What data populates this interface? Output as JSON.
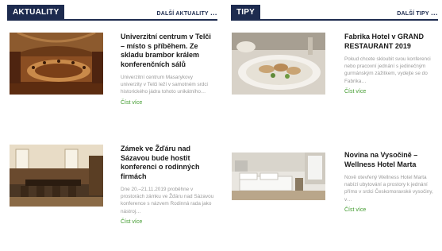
{
  "news": {
    "heading": "AKTUALITY",
    "more_label": "DALŠÍ AKTUALITY",
    "articles": [
      {
        "title": "Univerzitní centrum v Telči – místo s příběhem. Ze skladu brambor králem konferenčních sálů",
        "excerpt": "Univerzitní centrum Masarykovy univerzity v Telči leží v samotném srdci historického jádra tohoto unikátního…",
        "more": "Číst více"
      },
      {
        "title": "Zámek ve Žďáru nad Sázavou bude hostit konferenci o rodinných firmách",
        "excerpt": "Dne 20.–21.11.2019 proběhne v prostorách zámku ve Žďáru nad Sázavou konference s názvem Rodinná rada jako nástroj…",
        "more": "Číst více"
      }
    ]
  },
  "tips": {
    "heading": "TIPY",
    "more_label": "DALŠÍ TIPY",
    "articles": [
      {
        "title": "Fabrika Hotel v GRAND RESTAURANT 2019",
        "excerpt": "Pokud chcete skloubit svou konferenci nebo pracovní jednání s jedinečným gurmánským zážitkem, vydejte se do Fabrika…",
        "more": "Číst více"
      },
      {
        "title": "Novina na Vysočině – Wellness Hotel Marta",
        "excerpt": "Nově otevřený Wellness Hotel Marta nabízí ubytování a prostory k jednání přímo v srdci Českomoravské vysočiny, v…",
        "more": "Číst více"
      }
    ]
  },
  "colors": {
    "navy": "#1d2b4f",
    "link_green": "#3f9a2c",
    "excerpt_gray": "#9a9a9a"
  }
}
